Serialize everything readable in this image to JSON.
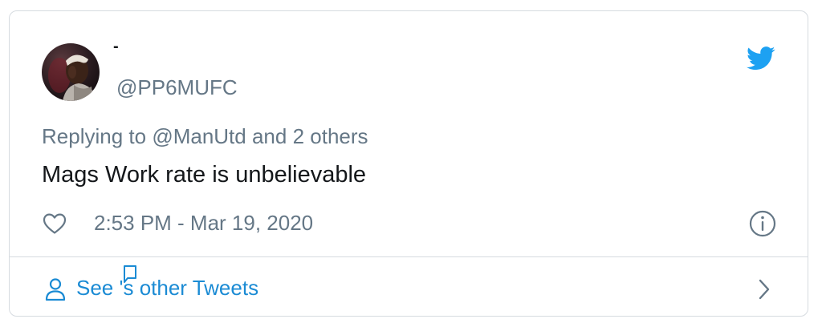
{
  "tweet": {
    "display_name": "-",
    "handle": "@PP6MUFC",
    "reply_prefix": "Replying to ",
    "reply_target": "@ManUtd",
    "reply_suffix": " and 2 others",
    "text": "Mags Work rate is unbelievable",
    "timestamp": "2:53 PM - Mar 19, 2020",
    "icons": {
      "brand": "twitter-bird-icon",
      "like": "heart-icon",
      "info": "info-icon",
      "person": "person-icon",
      "chevron": "chevron-right-icon"
    },
    "colors": {
      "brand": "#1da1f2",
      "link": "#1b8bd4",
      "muted": "#657786",
      "text": "#14171a",
      "border": "#d6dbe0"
    }
  },
  "footer": {
    "see_prefix": "See ",
    "see_suffix": "'s other Tweets"
  }
}
